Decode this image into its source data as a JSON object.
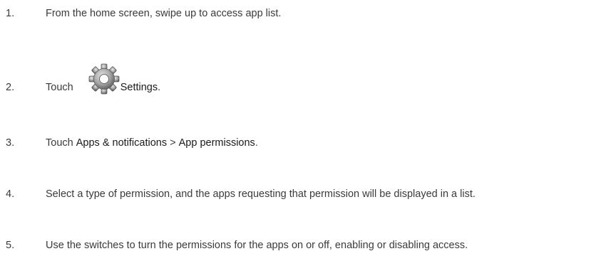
{
  "steps": [
    {
      "number": "1.",
      "text": "From the home screen, swipe up to access app list."
    },
    {
      "number": "2.",
      "prefix": "Touch",
      "icon": "gear-icon",
      "ui_label": "Settings",
      "suffix": "."
    },
    {
      "number": "3.",
      "prefix": "Touch ",
      "ui_label_1": "Apps & notifications",
      "separator": " > ",
      "ui_label_2": "App permissions",
      "suffix": "."
    },
    {
      "number": "4.",
      "text": "Select a type of permission, and the apps requesting that permission will be displayed in a list."
    },
    {
      "number": "5.",
      "text": "Use the switches to turn the permissions for the apps on or off, enabling or disabling access."
    }
  ],
  "colors": {
    "text": "#3a3a3a",
    "ui_label": "#1a1a1a",
    "gear_dark": "#555555",
    "gear_light": "#c8c8c8"
  }
}
